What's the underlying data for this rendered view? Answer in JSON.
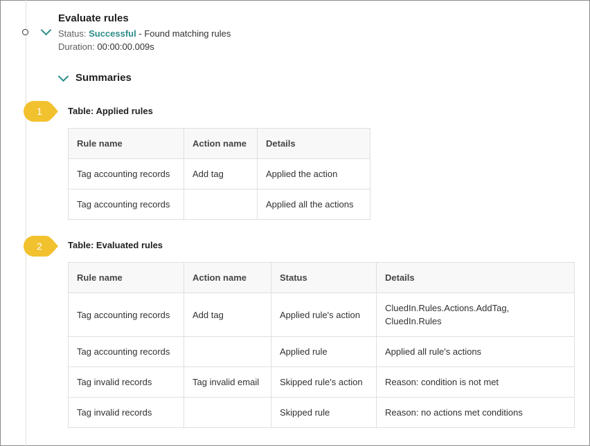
{
  "step": {
    "title": "Evaluate rules",
    "status_label": "Status:",
    "status_value": "Successful",
    "status_message": "- Found matching rules",
    "duration_label": "Duration:",
    "duration_value": "00:00:00.009s"
  },
  "summaries": {
    "title": "Summaries"
  },
  "callouts": [
    "1",
    "2"
  ],
  "badge_color": "#f2c12e",
  "accent_color": "#2b8c88",
  "applied": {
    "label": "Table:  Applied rules",
    "columns": [
      "Rule name",
      "Action name",
      "Details"
    ],
    "rows": [
      [
        "Tag accounting records",
        "Add tag",
        "Applied the action"
      ],
      [
        "Tag accounting records",
        "",
        "Applied all the actions"
      ]
    ]
  },
  "evaluated": {
    "label": "Table:  Evaluated rules",
    "columns": [
      "Rule name",
      "Action name",
      "Status",
      "Details"
    ],
    "rows": [
      [
        "Tag accounting records",
        "Add tag",
        "Applied rule's action",
        "CluedIn.Rules.Actions.AddTag, CluedIn.Rules"
      ],
      [
        "Tag accounting records",
        "",
        "Applied rule",
        "Applied all rule's actions"
      ],
      [
        "Tag invalid records",
        "Tag invalid email",
        "Skipped rule's action",
        "Reason: condition is not met"
      ],
      [
        "Tag invalid records",
        "",
        "Skipped rule",
        "Reason: no actions met conditions"
      ]
    ]
  }
}
